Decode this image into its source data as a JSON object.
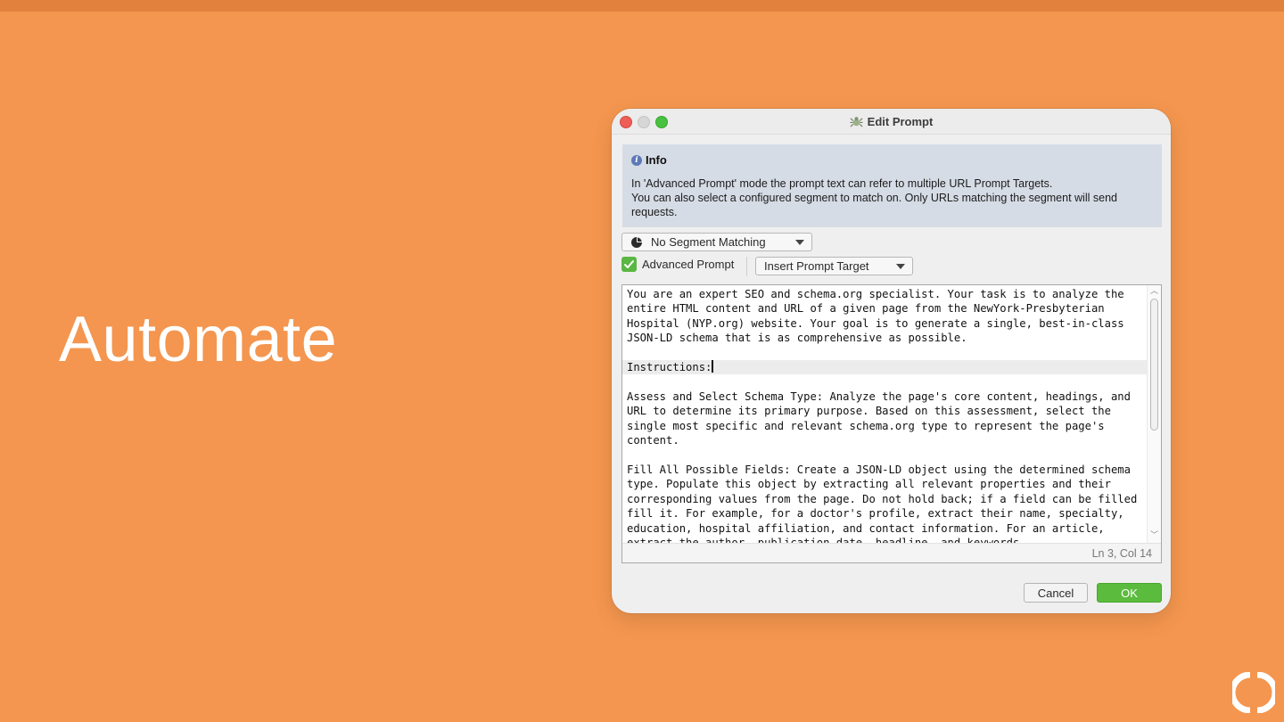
{
  "slide": {
    "heading": "Automate"
  },
  "dialog": {
    "title": "Edit Prompt",
    "app_icon": "spider-icon",
    "info": {
      "title": "Info",
      "lines": [
        "In 'Advanced Prompt' mode the prompt text can refer to multiple URL Prompt Targets.",
        "You can also select a configured segment to match on. Only URLs matching the segment will send requests."
      ]
    },
    "segment_select": {
      "icon": "pie-chart-icon",
      "value": "No Segment Matching"
    },
    "advanced_prompt": {
      "label": "Advanced Prompt",
      "checked": true
    },
    "insert_target": {
      "value": "Insert Prompt Target"
    },
    "editor": {
      "lines": [
        "You are an expert SEO and schema.org specialist. Your task is to analyze the",
        "entire HTML content and URL of a given page from the NewYork-Presbyterian",
        "Hospital (NYP.org) website. Your goal is to generate a single, best-in-class",
        "JSON-LD schema that is as comprehensive as possible.",
        "",
        "Instructions:",
        "",
        "Assess and Select Schema Type: Analyze the page's core content, headings, and",
        "URL to determine its primary purpose. Based on this assessment, select the",
        "single most specific and relevant schema.org type to represent the page's",
        "content.",
        "",
        "Fill All Possible Fields: Create a JSON-LD object using the determined schema",
        "type. Populate this object by extracting all relevant properties and their",
        "corresponding values from the page. Do not hold back; if a field can be filled",
        "fill it. For example, for a doctor's profile, extract their name, specialty,",
        "education, hospital affiliation, and contact information. For an article,",
        "extract the author, publication date, headline, and keywords."
      ],
      "current_line_index": 5,
      "status": "Ln 3, Col 14"
    },
    "buttons": {
      "cancel": "Cancel",
      "ok": "OK"
    }
  },
  "colors": {
    "background": "#f4964f",
    "top_bar": "#e2803d",
    "ok_button": "#5bbb3d",
    "info_panel": "#d6dce6"
  }
}
